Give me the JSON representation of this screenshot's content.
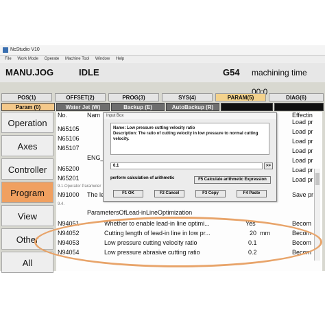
{
  "window": {
    "title": "NcStudio V10"
  },
  "menu": [
    "File",
    "Work Mode",
    "Operate",
    "Machine Tool",
    "Window",
    "Help"
  ],
  "status": {
    "mode": "MANU.JOG",
    "state": "IDLE",
    "coord": "G54",
    "machining_time_label": "machining time 00:0"
  },
  "tabs_main": [
    "POS(1)",
    "OFFSET(2)",
    "PROG(3)",
    "SYS(4)",
    "PARAM(5)",
    "DIAG(6)"
  ],
  "tabs_sub": [
    "Param (0)",
    "Water Jet (W)",
    "Backup (E)",
    "AutoBackup (R)"
  ],
  "sidebar": [
    "Operation",
    "Axes",
    "Controller",
    "Program",
    "View",
    "Other",
    "All"
  ],
  "table": {
    "header_no": "No.",
    "header_name": "Nam",
    "header_effect": "Effectin",
    "top_codes": [
      "N65105",
      "N65106",
      "N65107"
    ],
    "load_text": "Load pr",
    "eng_text": "ENG_",
    "mid_codes": [
      "N65200",
      "N65201"
    ],
    "section_operator": "9.1.Operator Parameter",
    "n91000": {
      "code": "N91000",
      "name": "The le",
      "effect": "Save pr"
    },
    "section_94": "9.4.",
    "group_title": "ParametersOfLead-inLineOptimization",
    "rows": [
      {
        "code": "N94051",
        "name": "Whether to enable lead-in line optimi...",
        "value": "Yes",
        "effect": "Becom"
      },
      {
        "code": "N94052",
        "name": "Cutting length of lead-in line in low pr...",
        "value": "20  mm",
        "effect": "Becom"
      },
      {
        "code": "N94053",
        "name": "Low pressure cutting velocity ratio",
        "value": "0.1",
        "effect": "Becom"
      },
      {
        "code": "N94054",
        "name": "Low pressure abrasive cutting ratio",
        "value": "0.2",
        "effect": "Becom"
      }
    ]
  },
  "dialog": {
    "title": "Input Box",
    "name_line": "Name:  Low pressure cutting velocity ratio",
    "desc_line": "Description:  The ratio of cutting velocity in low pressure to normal cutting velocity.",
    "input_value": "0.1",
    "more_btn": ">>",
    "perform_label": "perform calculation of arithmetic",
    "calc_btn": "F5 Calculate arithmetic Expression",
    "btn_ok": "F1 OK",
    "btn_cancel": "F2 Cancel",
    "btn_copy": "F3 Copy",
    "btn_paste": "F4 Paste"
  },
  "colors": {
    "accent_orange": "#f0a060",
    "highlight_oval": "#e8a46a",
    "active_tab": "#f3d28c"
  }
}
